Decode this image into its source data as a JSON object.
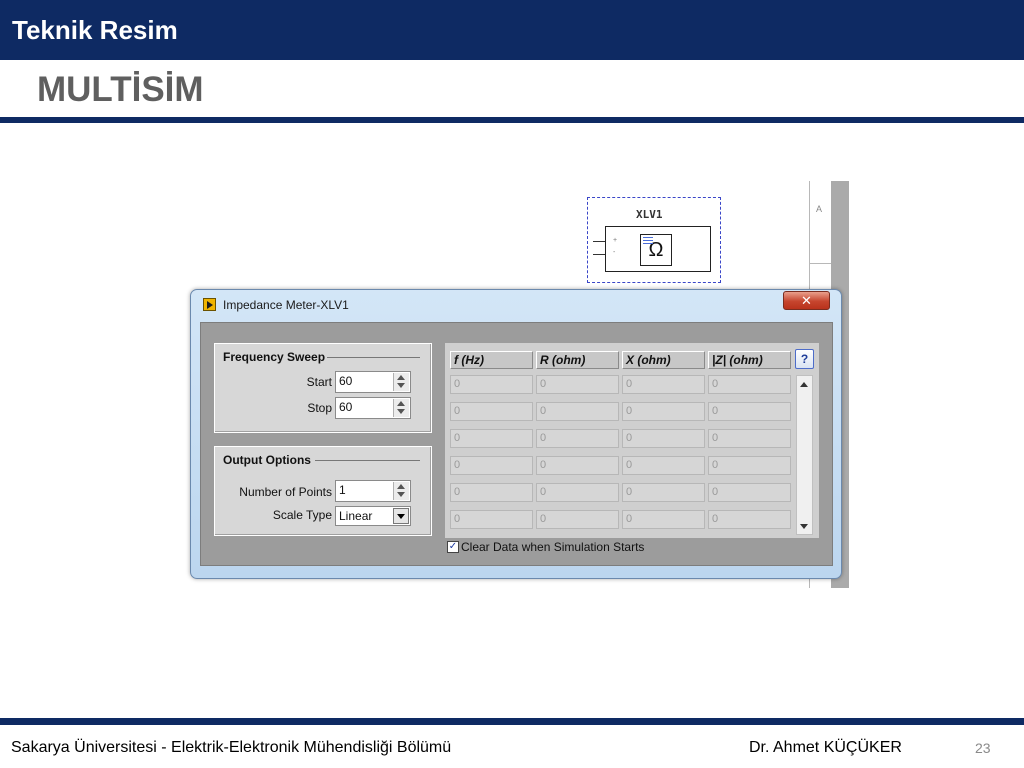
{
  "slide": {
    "header_title": "Teknik Resim",
    "heading": "MULTİSİM",
    "footer_left": "Sakarya Üniversitesi  - Elektrik-Elektronik Mühendisliği Bölümü",
    "footer_author": "Dr. Ahmet KÜÇÜKER",
    "page_number": "23"
  },
  "schematic": {
    "instrument_label": "XLV1",
    "sheet_column": "A",
    "pins": [
      "+",
      "-"
    ],
    "icon_symbol": "Ω"
  },
  "dialog": {
    "title": "Impedance Meter-XLV1",
    "close_glyph": "✕",
    "frequency_sweep": {
      "title": "Frequency Sweep",
      "start_label": "Start",
      "start_value": "60",
      "stop_label": "Stop",
      "stop_value": "60"
    },
    "output_options": {
      "title": "Output Options",
      "points_label": "Number of Points",
      "points_value": "1",
      "scale_label": "Scale Type",
      "scale_value": "Linear"
    },
    "table": {
      "columns": [
        "f (Hz)",
        "R (ohm)",
        "X (ohm)",
        "|Z| (ohm)"
      ],
      "rows": [
        [
          "0",
          "0",
          "0",
          "0"
        ],
        [
          "0",
          "0",
          "0",
          "0"
        ],
        [
          "0",
          "0",
          "0",
          "0"
        ],
        [
          "0",
          "0",
          "0",
          "0"
        ],
        [
          "0",
          "0",
          "0",
          "0"
        ],
        [
          "0",
          "0",
          "0",
          "0"
        ]
      ]
    },
    "help_label": "?",
    "clear_data": {
      "checked": true,
      "mark": "✓",
      "label": "Clear Data when Simulation Starts"
    }
  },
  "colors": {
    "brand_navy": "#0e2a63",
    "heading_gray": "#5f5f5f",
    "dialog_frame": "#c9dff4",
    "close_red": "#c6452e"
  }
}
